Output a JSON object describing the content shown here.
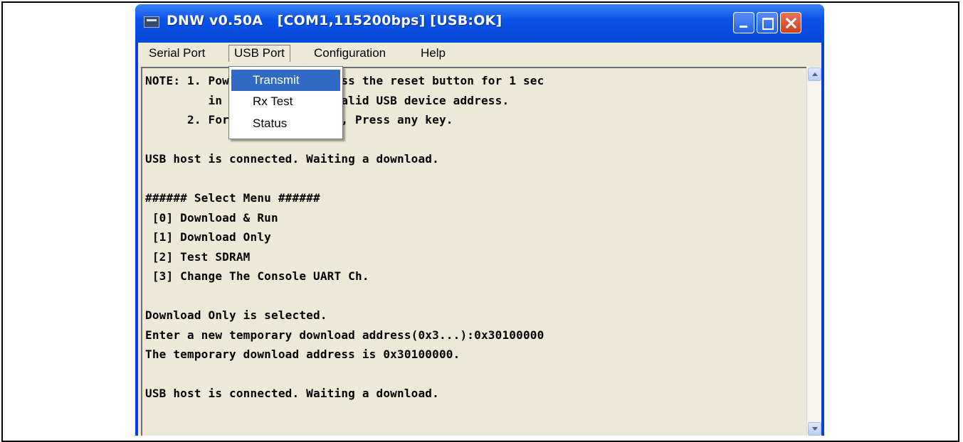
{
  "window": {
    "title": "DNW v0.50A   [COM1,115200bps] [USB:OK]"
  },
  "menubar": {
    "items": [
      {
        "label": "Serial Port"
      },
      {
        "label": "USB Port"
      },
      {
        "label": "Configuration"
      },
      {
        "label": "Help"
      }
    ]
  },
  "usb_menu": {
    "items": [
      {
        "label": "Transmit",
        "highlighted": true
      },
      {
        "label": "Rx Test"
      },
      {
        "label": "Status"
      }
    ]
  },
  "terminal": {
    "lines": [
      "NOTE: 1. Power off/on or press the reset button for 1 sec",
      "         in order to get a valid USB device address.",
      "      2. For additional menu, Press any key.",
      "",
      "USB host is connected. Waiting a download.",
      "",
      "###### Select Menu ######",
      " [0] Download & Run",
      " [1] Download Only",
      " [2] Test SDRAM",
      " [3] Change The Console UART Ch.",
      "",
      "Download Only is selected.",
      "Enter a new temporary download address(0x3...):0x30100000",
      "The temporary download address is 0x30100000.",
      "",
      "USB host is connected. Waiting a download."
    ]
  }
}
